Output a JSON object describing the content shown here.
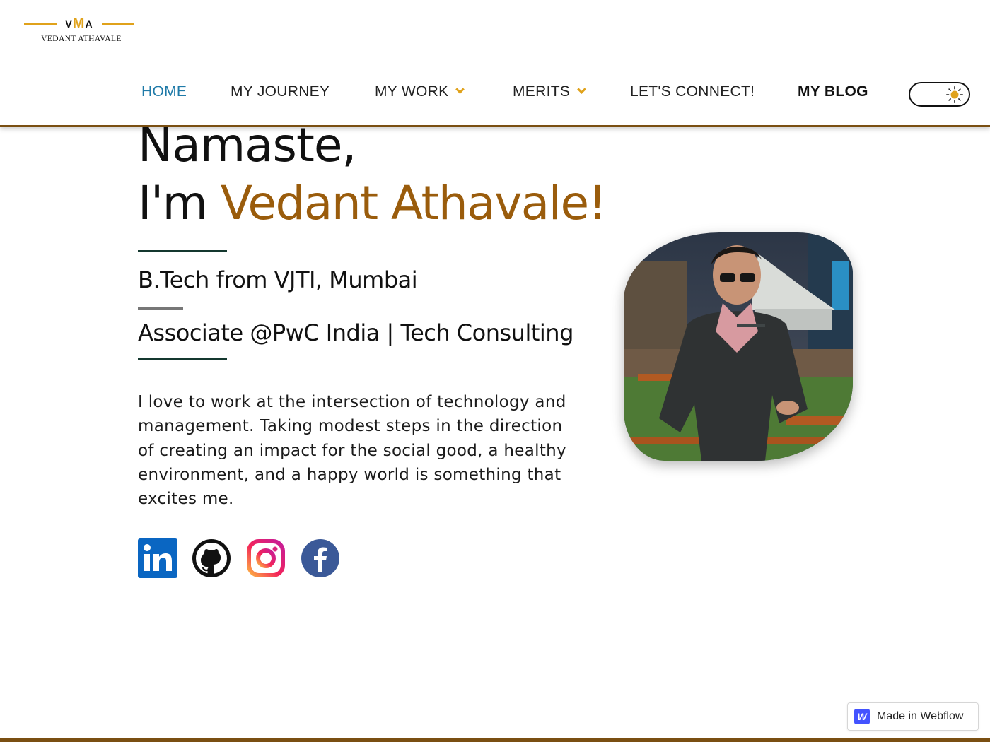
{
  "logo": {
    "mark_left": "V",
    "mark_mid": "M",
    "mark_right": "A",
    "name": "VEDANT ATHAVALE"
  },
  "nav": {
    "home": "HOME",
    "journey": "MY JOURNEY",
    "work": "MY WORK",
    "merits": "MERITS",
    "connect": "LET'S CONNECT!",
    "blog": "MY BLOG"
  },
  "theme_toggle": {
    "icon": "sun-icon",
    "mode": "light"
  },
  "hero": {
    "greeting": "Namaste,",
    "intro_prefix": "I'm ",
    "intro_name": "Vedant Athavale!",
    "education": "B.Tech from VJTI, Mumbai",
    "role": "Associate @PwC India | Tech Consulting",
    "bio": "I love to work at the intersection of technology and management. Taking modest steps in the direction of creating an impact for the social good, a healthy environment, and a happy world is something that excites me."
  },
  "social": [
    "linkedin-icon",
    "github-icon",
    "instagram-icon",
    "facebook-icon"
  ],
  "colors": {
    "accent": "#9a5c0c",
    "gold": "#e0a21b",
    "nav_active": "#1f7aa8",
    "divider": "#14382f"
  },
  "badge": {
    "label": "Made in Webflow",
    "logo": "W"
  }
}
